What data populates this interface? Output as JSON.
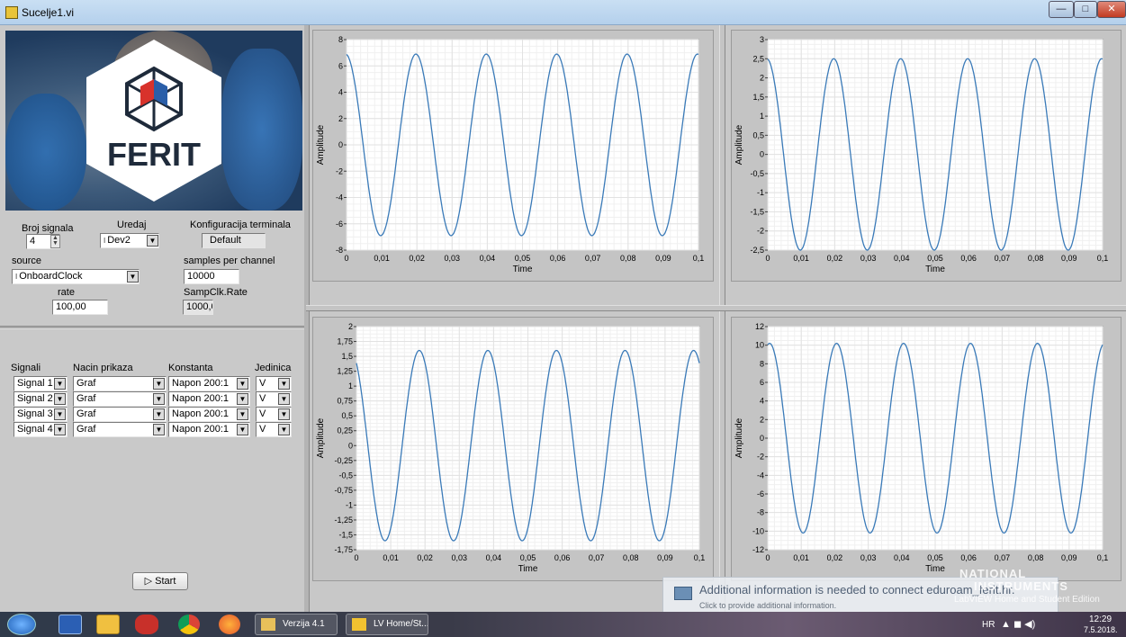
{
  "window": {
    "title": "Sucelje1.vi",
    "min_glyph": "—",
    "max_glyph": "□",
    "close_glyph": "✕"
  },
  "logo": {
    "text": "FERIT"
  },
  "config": {
    "broj_signala_label": "Broj signala",
    "broj_signala_value": "4",
    "uredaj_label": "Uredaj",
    "uredaj_value": "Dev2",
    "konfig_label": "Konfiguracija terminala",
    "konfig_value": "Default",
    "source_label": "source",
    "source_value": "OnboardClock",
    "spc_label": "samples per channel",
    "spc_value": "10000",
    "rate_label": "rate",
    "rate_value": "100,00",
    "sampclk_label": "SampClk.Rate",
    "sampclk_value": "1000,0"
  },
  "signal_table": {
    "headers": [
      "Signali",
      "Nacin prikaza",
      "Konstanta",
      "Jedinica"
    ],
    "rows": [
      {
        "signal": "Signal 1",
        "nacin": "Graf",
        "konstanta": "Napon 200:1",
        "jedinica": "V"
      },
      {
        "signal": "Signal 2",
        "nacin": "Graf",
        "konstanta": "Napon 200:1",
        "jedinica": "V"
      },
      {
        "signal": "Signal 3",
        "nacin": "Graf",
        "konstanta": "Napon 200:1",
        "jedinica": "V"
      },
      {
        "signal": "Signal 4",
        "nacin": "Graf",
        "konstanta": "Napon 200:1",
        "jedinica": "V"
      }
    ]
  },
  "start_button": {
    "label": "Start",
    "glyph": "▷"
  },
  "chart_data": [
    {
      "type": "line",
      "xlabel": "Time",
      "ylabel": "Amplitude",
      "xlim": [
        0,
        0.1
      ],
      "ylim": [
        -8,
        8
      ],
      "xticks": [
        "0",
        "0,01",
        "0,02",
        "0,03",
        "0,04",
        "0,05",
        "0,06",
        "0,07",
        "0,08",
        "0,09",
        "0,1"
      ],
      "yticks": [
        "-8",
        "-6",
        "-4",
        "-2",
        "0",
        "2",
        "4",
        "6",
        "8"
      ],
      "amplitude": 6.9,
      "frequency_hz": 50,
      "phase_deg": 95,
      "grid": true
    },
    {
      "type": "line",
      "xlabel": "Time",
      "ylabel": "Amplitude",
      "xlim": [
        0,
        0.1
      ],
      "ylim": [
        -2.5,
        3
      ],
      "xticks": [
        "0",
        "0,01",
        "0,02",
        "0,03",
        "0,04",
        "0,05",
        "0,06",
        "0,07",
        "0,08",
        "0,09",
        "0,1"
      ],
      "yticks": [
        "-2,5",
        "-2",
        "-1,5",
        "-1",
        "-0,5",
        "0",
        "0,5",
        "1",
        "1,5",
        "2",
        "2,5",
        "3"
      ],
      "amplitude": 2.5,
      "frequency_hz": 50,
      "phase_deg": 95,
      "grid": true
    },
    {
      "type": "line",
      "xlabel": "Time",
      "ylabel": "Amplitude",
      "xlim": [
        0,
        0.1
      ],
      "ylim": [
        -1.75,
        2
      ],
      "xticks": [
        "0",
        "0,01",
        "0,02",
        "0,03",
        "0,04",
        "0,05",
        "0,06",
        "0,07",
        "0,08",
        "0,09",
        "0,1"
      ],
      "yticks": [
        "-1,75",
        "-1,5",
        "-1,25",
        "-1",
        "-0,75",
        "-0,5",
        "-0,25",
        "0",
        "0,25",
        "0,5",
        "0,75",
        "1",
        "1,25",
        "1,5",
        "1,75",
        "2"
      ],
      "amplitude": 1.6,
      "frequency_hz": 50,
      "phase_deg": 120,
      "grid": true
    },
    {
      "type": "line",
      "xlabel": "Time",
      "ylabel": "Amplitude",
      "xlim": [
        0,
        0.1
      ],
      "ylim": [
        -12,
        12
      ],
      "xticks": [
        "0",
        "0,01",
        "0,02",
        "0,03",
        "0,04",
        "0,05",
        "0,06",
        "0,07",
        "0,08",
        "0,09",
        "0,1"
      ],
      "yticks": [
        "-12",
        "-10",
        "-8",
        "-6",
        "-4",
        "-2",
        "0",
        "2",
        "4",
        "6",
        "8",
        "10",
        "12"
      ],
      "amplitude": 10.2,
      "frequency_hz": 50,
      "phase_deg": 80,
      "grid": true
    }
  ],
  "notification": {
    "title": "Additional information is needed to connect eduroam_ferit.hr.",
    "subtitle": "Click to provide additional information."
  },
  "watermark": {
    "line1": "NATIONAL",
    "line2": "INSTRUMENTS",
    "line3": "LabVIEW  Home and Student Edition"
  },
  "taskbar": {
    "task1": "Verzija 4.1",
    "task2": "LV Home/St...",
    "lang": "HR",
    "tray": "▲  ◼  ◀)",
    "time": "12:29",
    "date": "7.5.2018."
  },
  "colors": {
    "trace": "#3a7ab8",
    "plot_bg": "#ffffff",
    "grid": "#e2e2e2"
  }
}
